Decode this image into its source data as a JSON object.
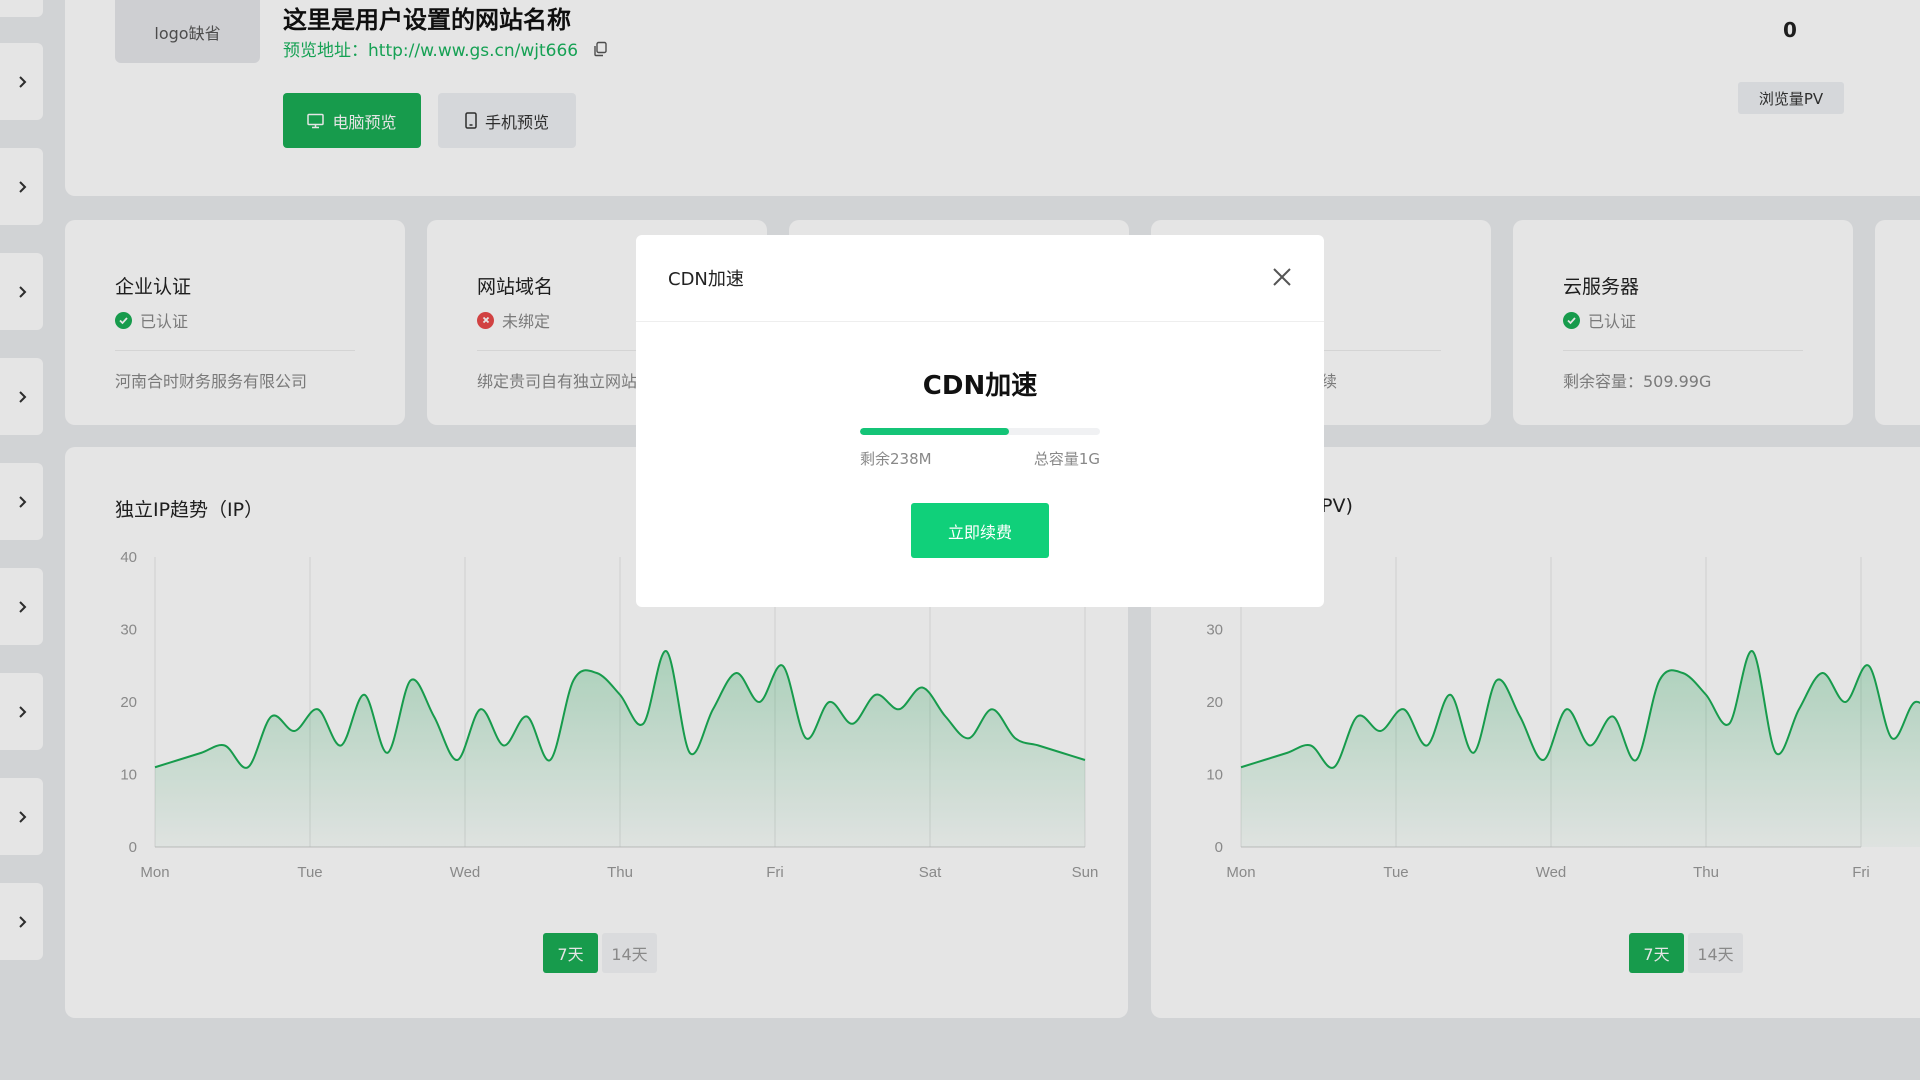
{
  "header": {
    "logo_placeholder": "logo缺省",
    "site_title": "这里是用户设置的网站名称",
    "preview_label": "预览地址：",
    "preview_url": "http://w.ww.gs.cn/wjt666",
    "pc_preview_label": "电脑预览",
    "mobile_preview_label": "手机预览",
    "pv_count": "0",
    "pv_label": "浏览量PV"
  },
  "info_cards": [
    {
      "title": "企业认证",
      "status": "已认证",
      "status_type": "ok",
      "desc": "河南合时财务服务有限公司"
    },
    {
      "title": "网站域名",
      "status": "未绑定",
      "status_type": "error",
      "desc": "绑定贵司自有独立网站"
    },
    {
      "desc_tail": "续"
    },
    {
      "title": "云服务器",
      "status": "已认证",
      "status_type": "ok",
      "desc": "剩余容量：509.99G"
    }
  ],
  "charts": {
    "ip": {
      "title": "独立IP趋势（IP）"
    },
    "pv": {
      "title_tail": "PV)"
    },
    "range_options": [
      "7天",
      "14天"
    ],
    "active_range": "7天"
  },
  "chart_data": [
    {
      "type": "area",
      "title": "独立IP趋势（IP）",
      "x_ticks": [
        "Mon",
        "Tue",
        "Wed",
        "Thu",
        "Fri",
        "Sat",
        "Sun"
      ],
      "ylim": [
        0,
        40
      ],
      "y_ticks": [
        0,
        10,
        20,
        30,
        40
      ],
      "grid": "vertical",
      "x": [
        0,
        0.15,
        0.3,
        0.45,
        0.6,
        0.75,
        0.9,
        1.05,
        1.2,
        1.35,
        1.5,
        1.65,
        1.8,
        1.95,
        2.1,
        2.25,
        2.4,
        2.55,
        2.7,
        2.85,
        3.0,
        3.15,
        3.3,
        3.45,
        3.6,
        3.75,
        3.9,
        4.05,
        4.2,
        4.35,
        4.5,
        4.65,
        4.8,
        4.95,
        5.1,
        5.25,
        5.4,
        5.55,
        5.7,
        5.85,
        6.0
      ],
      "values": [
        11,
        12,
        13,
        14,
        11,
        18,
        16,
        19,
        14,
        21,
        13,
        23,
        18,
        12,
        19,
        14,
        18,
        12,
        23,
        24,
        21,
        17,
        27,
        13,
        19,
        24,
        20,
        25,
        15,
        20,
        17,
        21,
        19,
        22,
        18,
        15,
        19,
        15,
        14,
        13,
        12
      ],
      "color": "#1aad55"
    },
    {
      "type": "area",
      "title_tail": "PV)",
      "x_ticks": [
        "Mon",
        "Tue",
        "Wed",
        "Thu",
        "Fri"
      ],
      "ylim": [
        0,
        40
      ],
      "y_ticks": [
        0,
        10,
        20,
        30
      ],
      "grid": "vertical",
      "x": [
        0,
        0.15,
        0.3,
        0.45,
        0.6,
        0.75,
        0.9,
        1.05,
        1.2,
        1.35,
        1.5,
        1.65,
        1.8,
        1.95,
        2.1,
        2.25,
        2.4,
        2.55,
        2.7,
        2.85,
        3.0,
        3.15,
        3.3,
        3.45,
        3.6,
        3.75,
        3.9,
        4.05,
        4.2,
        4.35,
        4.5
      ],
      "values": [
        11,
        12,
        13,
        14,
        11,
        18,
        16,
        19,
        14,
        21,
        13,
        23,
        18,
        12,
        19,
        14,
        18,
        12,
        23,
        24,
        21,
        17,
        27,
        13,
        19,
        24,
        20,
        25,
        15,
        20,
        17
      ],
      "color": "#1aad55"
    }
  ],
  "modal": {
    "header_title": "CDN加速",
    "heading": "CDN加速",
    "progress_fraction": 0.62,
    "remaining_label": "剩余238M",
    "total_label": "总容量1G",
    "renew_label": "立即续费"
  },
  "colors": {
    "accent": "#1aad55",
    "renew_button": "#10d07a",
    "error": "#e94a4a"
  }
}
